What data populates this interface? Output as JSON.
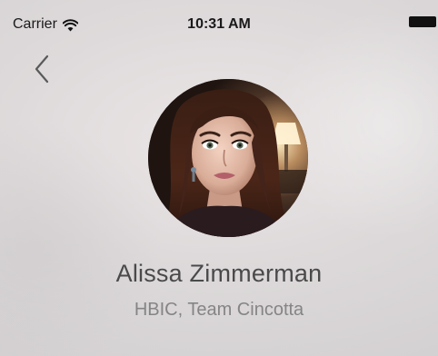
{
  "status_bar": {
    "carrier": "Carrier",
    "time": "10:31 AM",
    "icons": [
      "wifi-icon",
      "battery-icon"
    ]
  },
  "navigation": {
    "back_icon": "chevron-left-icon"
  },
  "profile": {
    "name": "Alissa Zimmerman",
    "title": "HBIC, Team Cincotta",
    "avatar_icon": "profile-photo"
  },
  "colors": {
    "background": "#dcd8d8",
    "name_text": "#4a4a4a",
    "title_text": "#858585",
    "status_text": "#1a1a1a"
  }
}
